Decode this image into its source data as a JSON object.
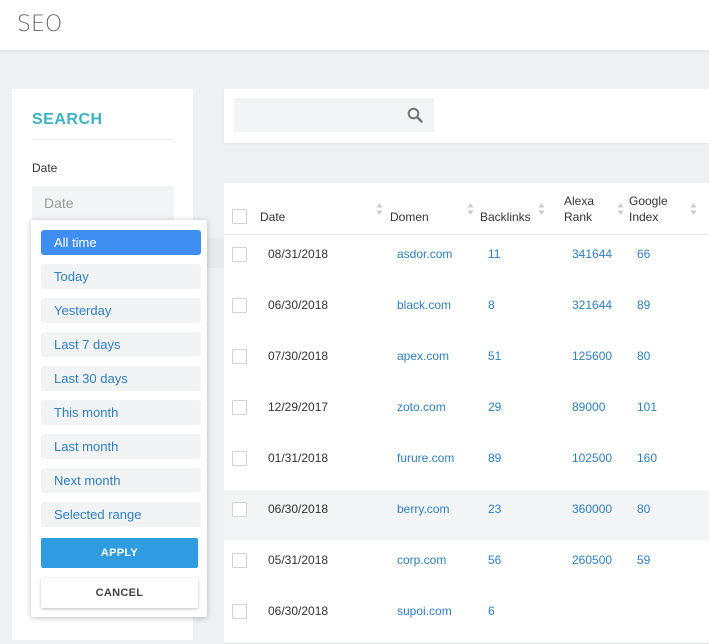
{
  "header": {
    "title": "SEO"
  },
  "sidebar": {
    "heading": "SEARCH",
    "date_label": "Date",
    "date_placeholder": "Date"
  },
  "dropdown": {
    "options": [
      {
        "label": "All time",
        "active": true
      },
      {
        "label": "Today"
      },
      {
        "label": "Yesterday"
      },
      {
        "label": "Last 7 days"
      },
      {
        "label": "Last 30 days"
      },
      {
        "label": "This month"
      },
      {
        "label": "Last month"
      },
      {
        "label": "Next month"
      },
      {
        "label": "Selected range"
      }
    ],
    "apply_label": "APPLY",
    "cancel_label": "CANCEL"
  },
  "search": {
    "placeholder": ""
  },
  "table": {
    "columns": {
      "date": "Date",
      "domain": "Domen",
      "backlinks": "Backlinks",
      "alexa_line1": "Alexa",
      "alexa_line2": "Rank",
      "google_line1": "Google",
      "google_line2": "Index"
    },
    "rows": [
      {
        "date": "08/31/2018",
        "domain": "asdor.com",
        "backlinks": "11",
        "alexa": "341644",
        "google": "66"
      },
      {
        "date": "06/30/2018",
        "domain": "black.com",
        "backlinks": "8",
        "alexa": "321644",
        "google": "89"
      },
      {
        "date": "07/30/2018",
        "domain": "apex.com",
        "backlinks": "51",
        "alexa": "125600",
        "google": "80"
      },
      {
        "date": "12/29/2017",
        "domain": "zoto.com",
        "backlinks": "29",
        "alexa": "89000",
        "google": "101"
      },
      {
        "date": "01/31/2018",
        "domain": "furure.com",
        "backlinks": "89",
        "alexa": "102500",
        "google": "160"
      },
      {
        "date": "06/30/2018",
        "domain": "berry.com",
        "backlinks": "23",
        "alexa": "360000",
        "google": "80",
        "highlighted": true
      },
      {
        "date": "05/31/2018",
        "domain": "corp.com",
        "backlinks": "56",
        "alexa": "260500",
        "google": "59"
      },
      {
        "date": "06/30/2018",
        "domain": "supoi.com",
        "backlinks": "6",
        "alexa": "",
        "google": ""
      }
    ]
  },
  "colors": {
    "accent": "#3bb3c3",
    "link": "#2d7ec4",
    "active_option": "#3d8ef0",
    "apply_button": "#2f9be0"
  }
}
